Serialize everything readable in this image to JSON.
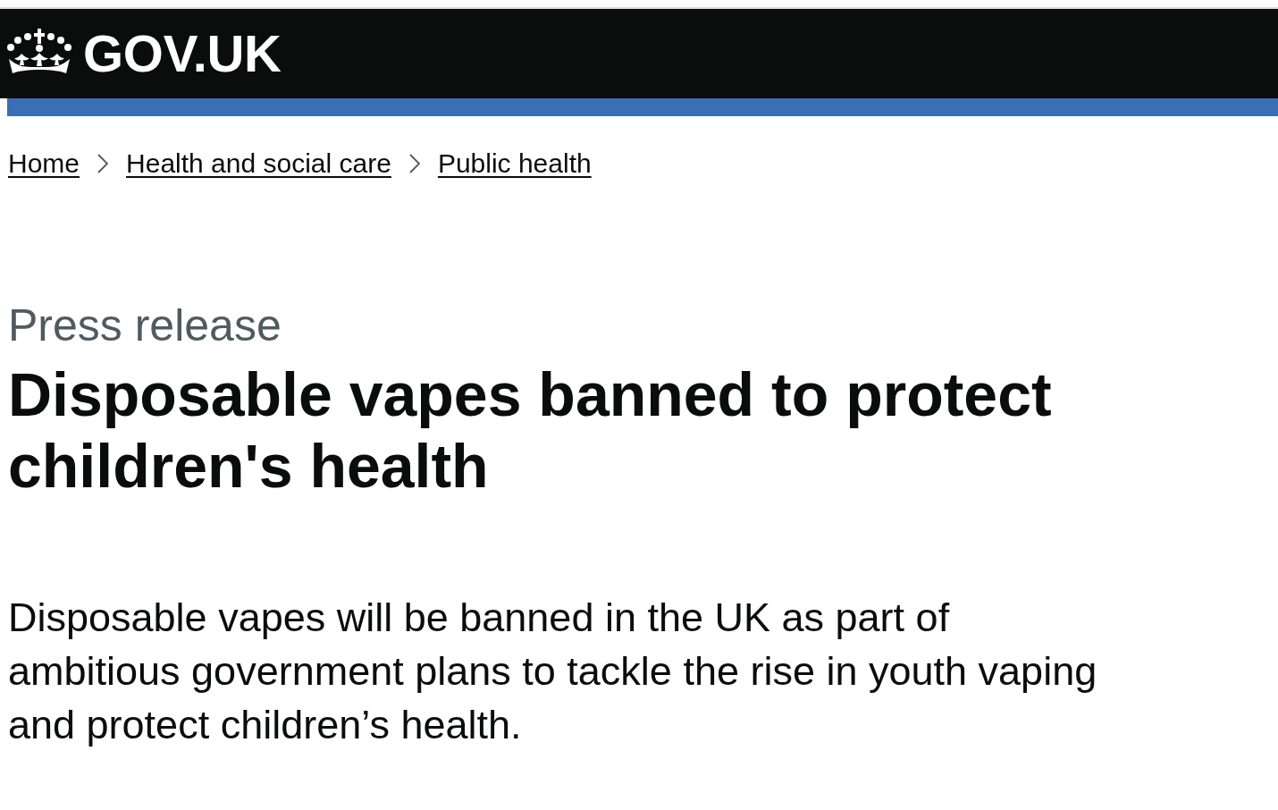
{
  "header": {
    "logo_text": "GOV.UK"
  },
  "breadcrumbs": [
    {
      "label": "Home"
    },
    {
      "label": "Health and social care"
    },
    {
      "label": "Public health"
    }
  ],
  "article": {
    "document_type": "Press release",
    "title": "Disposable vapes banned to protect children's health",
    "lead": "Disposable vapes will be banned in the UK as part of ambitious government plans to tackle the rise in youth vaping and protect children’s health."
  }
}
